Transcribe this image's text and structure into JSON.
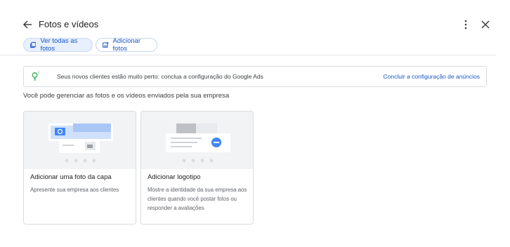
{
  "header": {
    "title": "Fotos e vídeos",
    "back_icon": "arrow-left-icon",
    "more_icon": "more-vert-icon",
    "close_icon": "close-icon"
  },
  "chips": [
    {
      "label": "Ver todas as fotos",
      "icon": "photo-library-icon",
      "active": true
    },
    {
      "label": "Adicionar fotos",
      "icon": "add-photo-icon",
      "active": false
    }
  ],
  "banner": {
    "icon": "lightbulb-icon",
    "text": "Seus novos clientes estão muito perto: conclua a configuração do Google Ads",
    "link": "Concluir a configuração de anúncios"
  },
  "subtitle": "Você pode gerenciar as fotos e os vídeos enviados pela sua empresa",
  "cards": [
    {
      "title": "Adicionar uma foto da capa",
      "description": "Apresente sua empresa aos clientes"
    },
    {
      "title": "Adicionar logotipo",
      "description": "Mostre a identidade da sua empresa aos clientes quando você postar fotos ou responder a avaliações"
    }
  ],
  "colors": {
    "accent": "#1a56c4",
    "chip_bg": "#e8f0fe",
    "illustration_bg": "#f1f3f4",
    "bulb": "#34a853"
  }
}
